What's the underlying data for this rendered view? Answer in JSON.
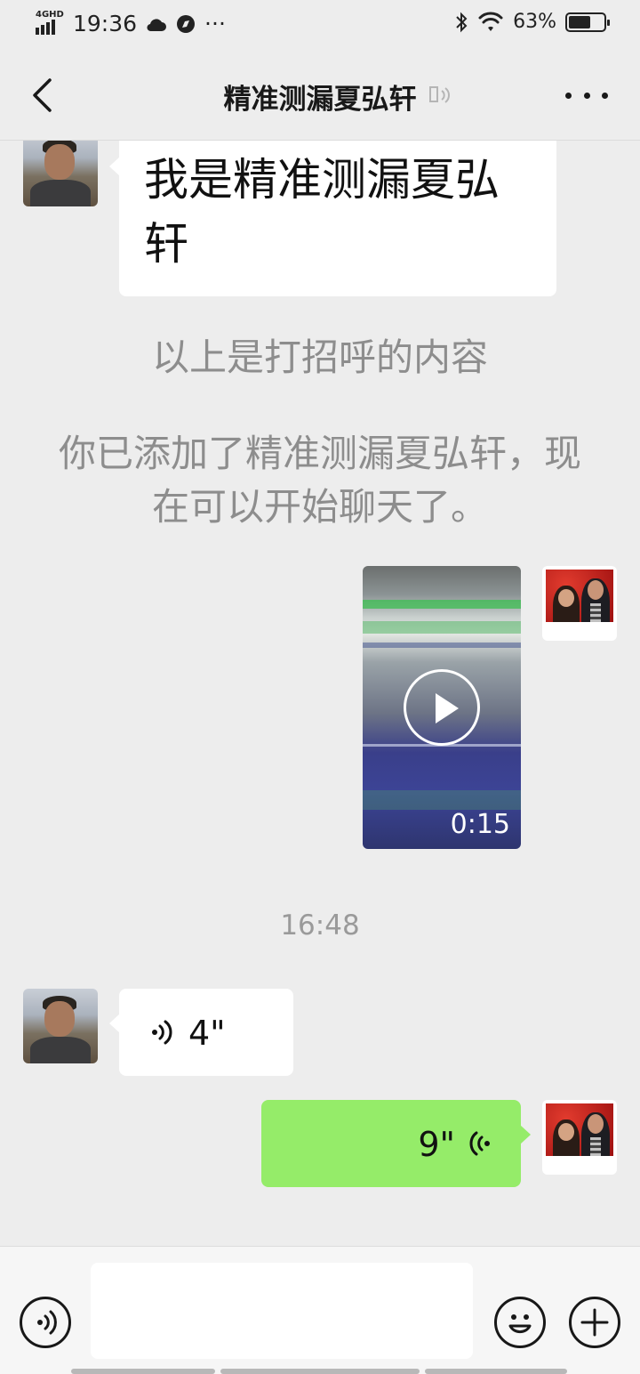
{
  "status_bar": {
    "network": "4GHD",
    "time": "19:36",
    "extra": "···",
    "battery": "63%",
    "battery_level": 0.63
  },
  "nav": {
    "title": "精准测漏夏弘轩"
  },
  "messages": {
    "greeting": "我是精准测漏夏弘轩",
    "system_1": "以上是打招呼的内容",
    "system_2": "你已添加了精准测漏夏弘轩，现在可以开始聊天了。",
    "video_duration": "0:15",
    "timestamp": "16:48",
    "voice_in": "4\"",
    "voice_out": "9\""
  },
  "colors": {
    "background": "#ededed",
    "bubble_out": "#95ec69",
    "bubble_in": "#ffffff",
    "system_text": "#8d8d8d"
  },
  "icons": {
    "back": "back-arrow-icon",
    "mute": "earpiece-mode-icon",
    "more": "more-dots-icon",
    "voice_toggle": "voice-mode-icon",
    "emoji": "emoji-icon",
    "add": "plus-icon"
  }
}
